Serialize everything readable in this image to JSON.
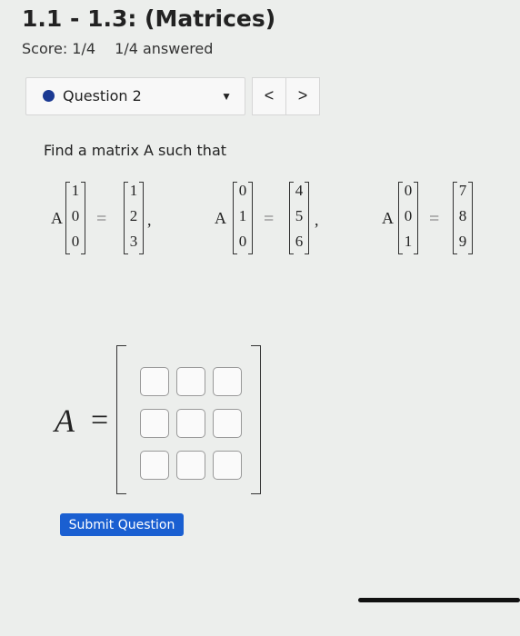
{
  "header": {
    "title": "1.1 - 1.3: (Matrices)",
    "score": "Score: 1/4",
    "answered": "1/4 answered"
  },
  "question_nav": {
    "label": "Question 2",
    "prev": "<",
    "next": ">"
  },
  "problem": {
    "prompt": "Find a matrix A such that",
    "matrix_symbol": "A",
    "equals": "=",
    "equations": [
      {
        "input": [
          "1",
          "0",
          "0"
        ],
        "output": [
          "1",
          "2",
          "3"
        ]
      },
      {
        "input": [
          "0",
          "1",
          "0"
        ],
        "output": [
          "4",
          "5",
          "6"
        ]
      },
      {
        "input": [
          "0",
          "0",
          "1"
        ],
        "output": [
          "7",
          "8",
          "9"
        ]
      }
    ]
  },
  "answer": {
    "label": "A =",
    "rows": 3,
    "cols": 3
  },
  "actions": {
    "submit_label": "Submit Question"
  },
  "colors": {
    "accent": "#1a5fd1",
    "question_dot": "#1b3a93"
  }
}
